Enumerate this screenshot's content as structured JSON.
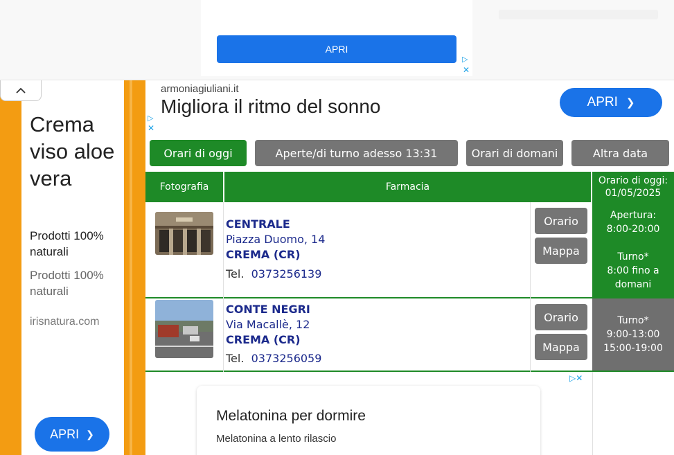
{
  "top_ad": {
    "button_label": "APRI",
    "adchoices_symbol": "▷",
    "close_symbol": "✕"
  },
  "collapse_symbol": "⌃",
  "side_ad": {
    "title": "Crema viso aloe vera",
    "desc_primary": "Prodotti 100% naturali",
    "desc_secondary": "Prodotti 100% naturali",
    "domain": "irisnatura.com",
    "button_label": "APRI",
    "button_chevron": "❯",
    "accent_color": "#f39c12"
  },
  "content_ad": {
    "domain": "armoniagiuliani.it",
    "headline": "Migliora il ritmo del sonno",
    "button_label": "APRI",
    "button_chevron": "❯",
    "adchoices_symbol": "▷",
    "close_symbol": "✕"
  },
  "tabs": [
    {
      "label": "Orari di oggi",
      "active": true
    },
    {
      "label": "Aperte/di turno adesso 13:31",
      "active": false
    },
    {
      "label": "Orari di domani",
      "active": false
    },
    {
      "label": "Altra data",
      "active": false
    }
  ],
  "table": {
    "headers": {
      "photo": "Fotografia",
      "pharmacy": "Farmacia",
      "hours_line1": "Orario di oggi:",
      "hours_line2": "01/05/2025"
    },
    "rows": [
      {
        "name": "CENTRALE",
        "address": "Piazza Duomo, 14",
        "city": "CREMA (CR)",
        "tel_label": "Tel.",
        "tel": "0373256139",
        "btn_hours": "Orario",
        "btn_map": "Mappa",
        "hours": [
          "Apertura:",
          "8:00-20:00",
          "",
          "Turno*",
          "8:00 fino a",
          "domani"
        ],
        "hours_color": "#1e8a27"
      },
      {
        "name": "CONTE NEGRI",
        "address": "Via Macallè, 12",
        "city": "CREMA (CR)",
        "tel_label": "Tel.",
        "tel": "0373256059",
        "btn_hours": "Orario",
        "btn_map": "Mappa",
        "hours": [
          "Turno*",
          "9:00-13:00",
          "15:00-19:00"
        ],
        "hours_color": "#6f6f6f"
      }
    ]
  },
  "bottom_ad": {
    "title": "Melatonina per dormire",
    "subtitle": "Melatonina a lento rilascio",
    "adchoices_symbol": "▷✕"
  },
  "colors": {
    "green": "#1e8a27",
    "grey": "#757575",
    "link_blue": "#1c2a8c",
    "ad_blue": "#1a73e8"
  }
}
